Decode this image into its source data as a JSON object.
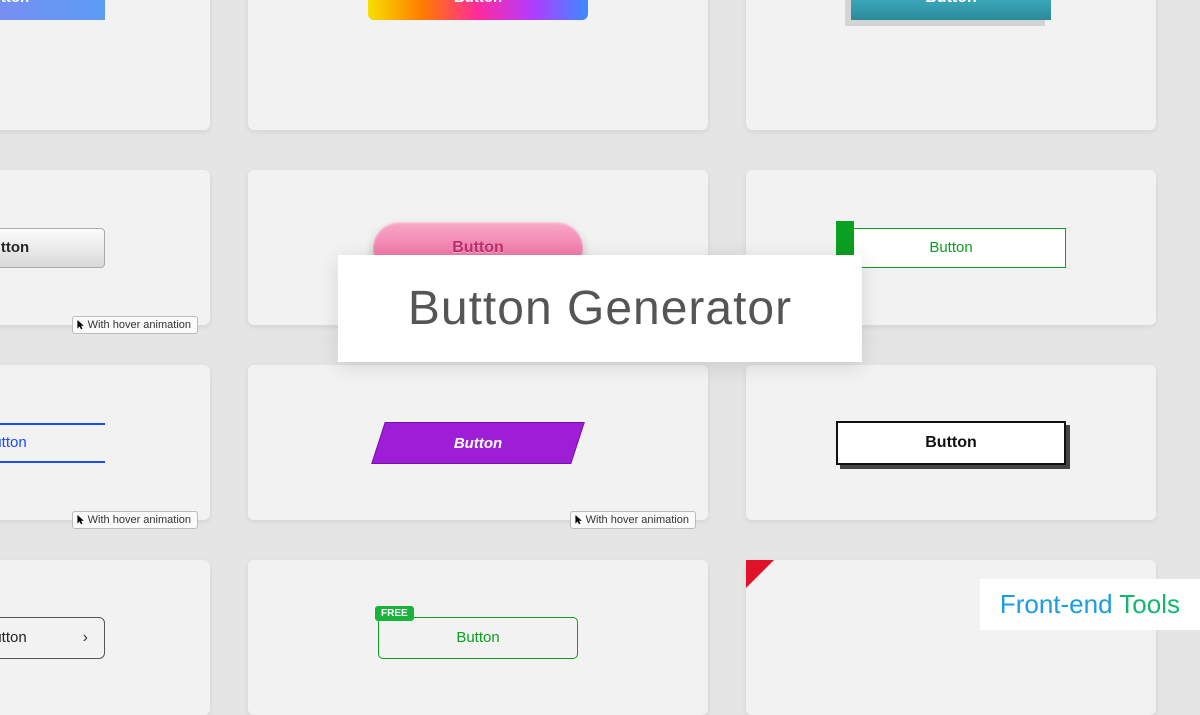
{
  "title": "Button Generator",
  "brand": {
    "part1": "Front-end ",
    "part2": "Tools"
  },
  "hover_label": "With hover animation",
  "buttons": {
    "grad_blue": "Button",
    "grad_rainbow": "Button",
    "grad_teal": "Button",
    "silver": "Button",
    "pink": "Button",
    "green_tab": "Button",
    "blue_lines": "Button",
    "purple_skew": "Button",
    "black_outline": "Button",
    "arrow": "Button",
    "free": "Button",
    "free_badge": "FREE"
  }
}
